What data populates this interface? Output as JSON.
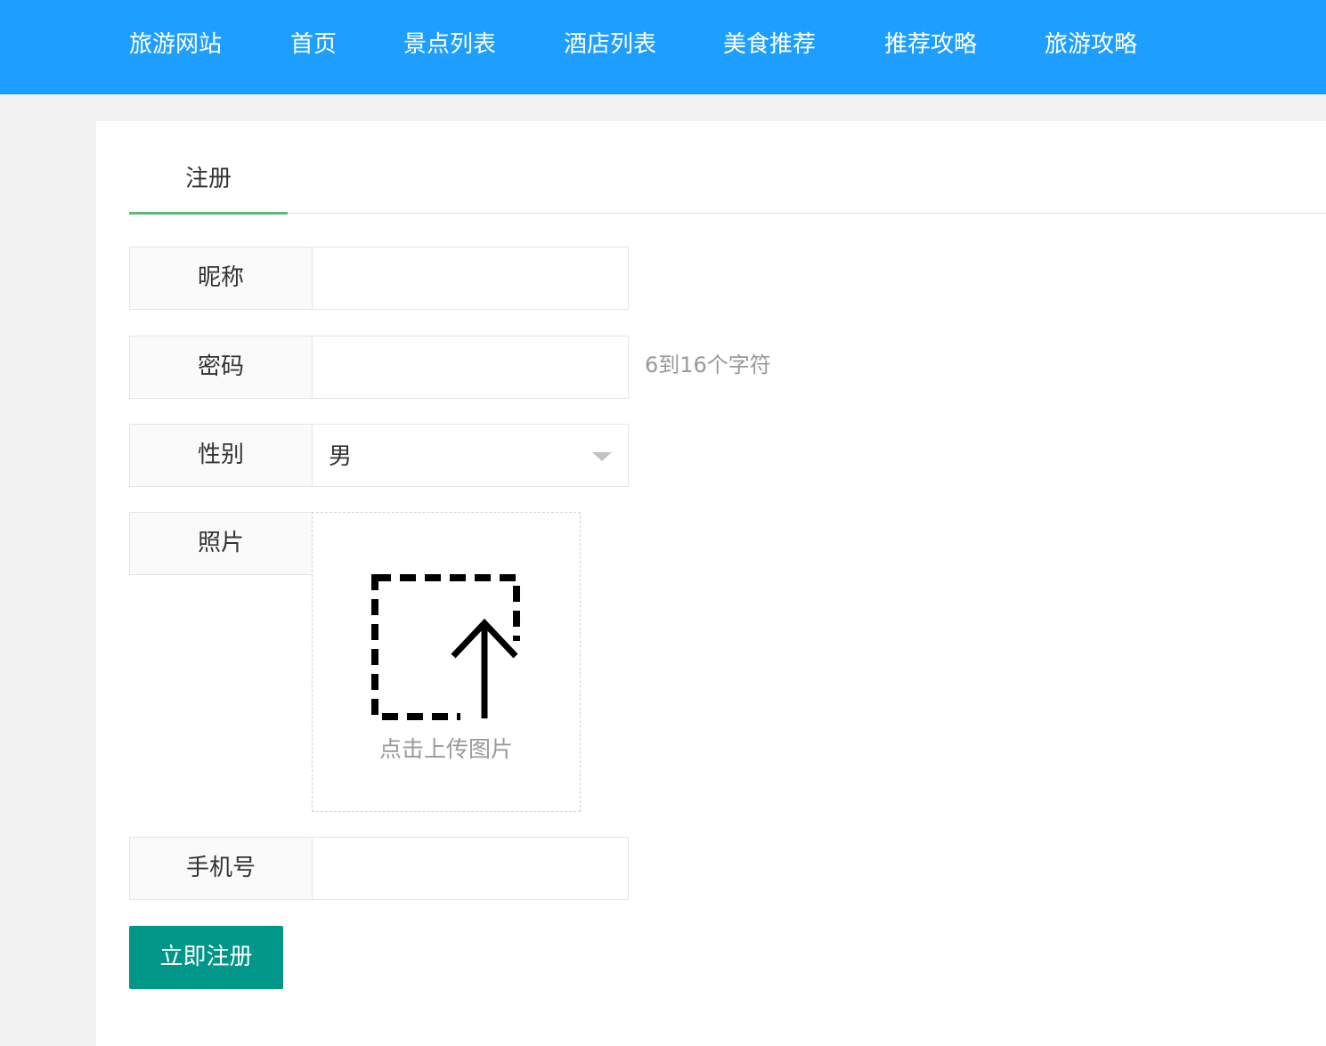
{
  "nav": {
    "brand": "旅游网站",
    "items": [
      "首页",
      "景点列表",
      "酒店列表",
      "美食推荐",
      "推荐攻略",
      "旅游攻略"
    ]
  },
  "tabs": {
    "active": "注册"
  },
  "form": {
    "nickname_label": "昵称",
    "nickname_value": "",
    "password_label": "密码",
    "password_value": "",
    "password_hint": "6到16个字符",
    "gender_label": "性别",
    "gender_value": "男",
    "photo_label": "照片",
    "upload_text": "点击上传图片",
    "upload_icon": "upload-icon",
    "phone_label": "手机号",
    "phone_value": "",
    "submit_label": "立即注册"
  },
  "colors": {
    "nav_bg": "#1e9fff",
    "tab_underline": "#5fb878",
    "submit_bg": "#009688"
  }
}
